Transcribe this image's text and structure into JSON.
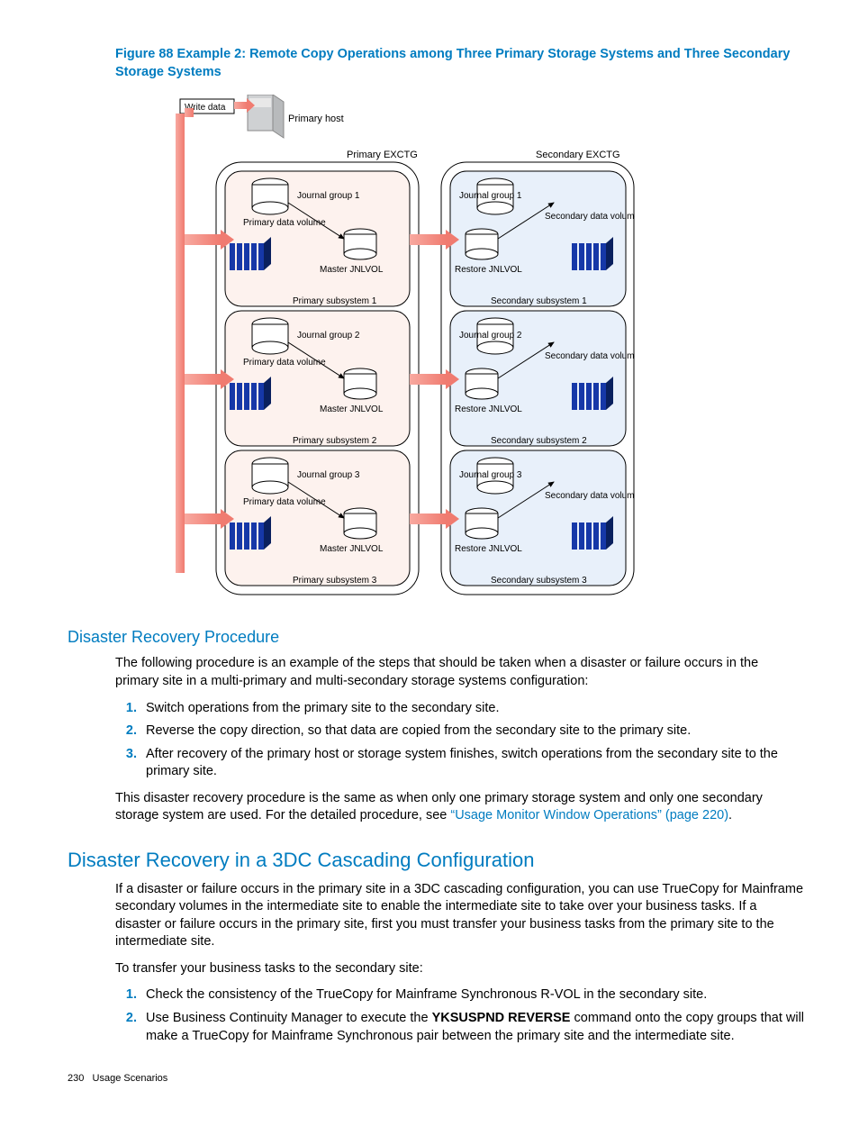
{
  "figure": {
    "title": "Figure 88 Example 2: Remote Copy Operations among Three Primary Storage Systems and Three Secondary Storage Systems",
    "labels": {
      "write_data": "Write data",
      "primary_host": "Primary host",
      "primary_exctg": "Primary  EXCTG",
      "secondary_exctg": "Secondary  EXCTG",
      "journal_group": [
        "Journal group 1",
        "Journal group 2",
        "Journal group 3"
      ],
      "primary_data_volume": "Primary data volume",
      "secondary_data_volume": "Secondary data volume",
      "master_jnlvol": "Master JNLVOL",
      "restore_jnlvol": "Restore JNLVOL",
      "primary_subsystem": [
        "Primary subsystem 1",
        "Primary subsystem 2",
        "Primary subsystem 3"
      ],
      "secondary_subsystem": [
        "Secondary subsystem 1",
        "Secondary subsystem 2",
        "Secondary subsystem 3"
      ]
    }
  },
  "sections": {
    "drp_heading": "Disaster Recovery Procedure",
    "drp_intro": "The following procedure is an example of the steps that should be taken when a disaster or failure occurs in the primary site in a multi-primary and multi-secondary storage systems configuration:",
    "drp_steps": [
      "Switch operations from the primary site to the secondary site.",
      "Reverse the copy direction, so that data are copied from the secondary site to the primary site.",
      "After recovery of the primary host or storage system finishes, switch operations from the secondary site to the primary site."
    ],
    "drp_outro_pre": "This disaster recovery procedure is the same as when only one primary storage system and only one secondary storage system are used. For the detailed procedure, see ",
    "drp_link": "“Usage Monitor Window Operations” (page 220)",
    "drp_outro_post": ".",
    "dr3dc_heading": "Disaster Recovery in a 3DC Cascading Configuration",
    "dr3dc_p1": "If a disaster or failure occurs in the primary site in a 3DC cascading configuration, you can use TrueCopy for Mainframe secondary volumes in the intermediate site to enable the intermediate site to take over your business tasks. If a disaster or failure occurs in the primary site, first you must transfer your business tasks from the primary site to the intermediate site.",
    "dr3dc_p2": "To transfer your business tasks to the secondary site:",
    "dr3dc_steps": [
      "Check the consistency of the TrueCopy for Mainframe Synchronous R-VOL in the secondary site.",
      {
        "pre": "Use Business Continuity Manager to execute the ",
        "bold": "YKSUSPND REVERSE",
        "post": " command onto the copy groups that will make a TrueCopy for Mainframe Synchronous pair between the primary site and the intermediate site."
      }
    ]
  },
  "footer": {
    "page": "230",
    "section": "Usage Scenarios"
  }
}
